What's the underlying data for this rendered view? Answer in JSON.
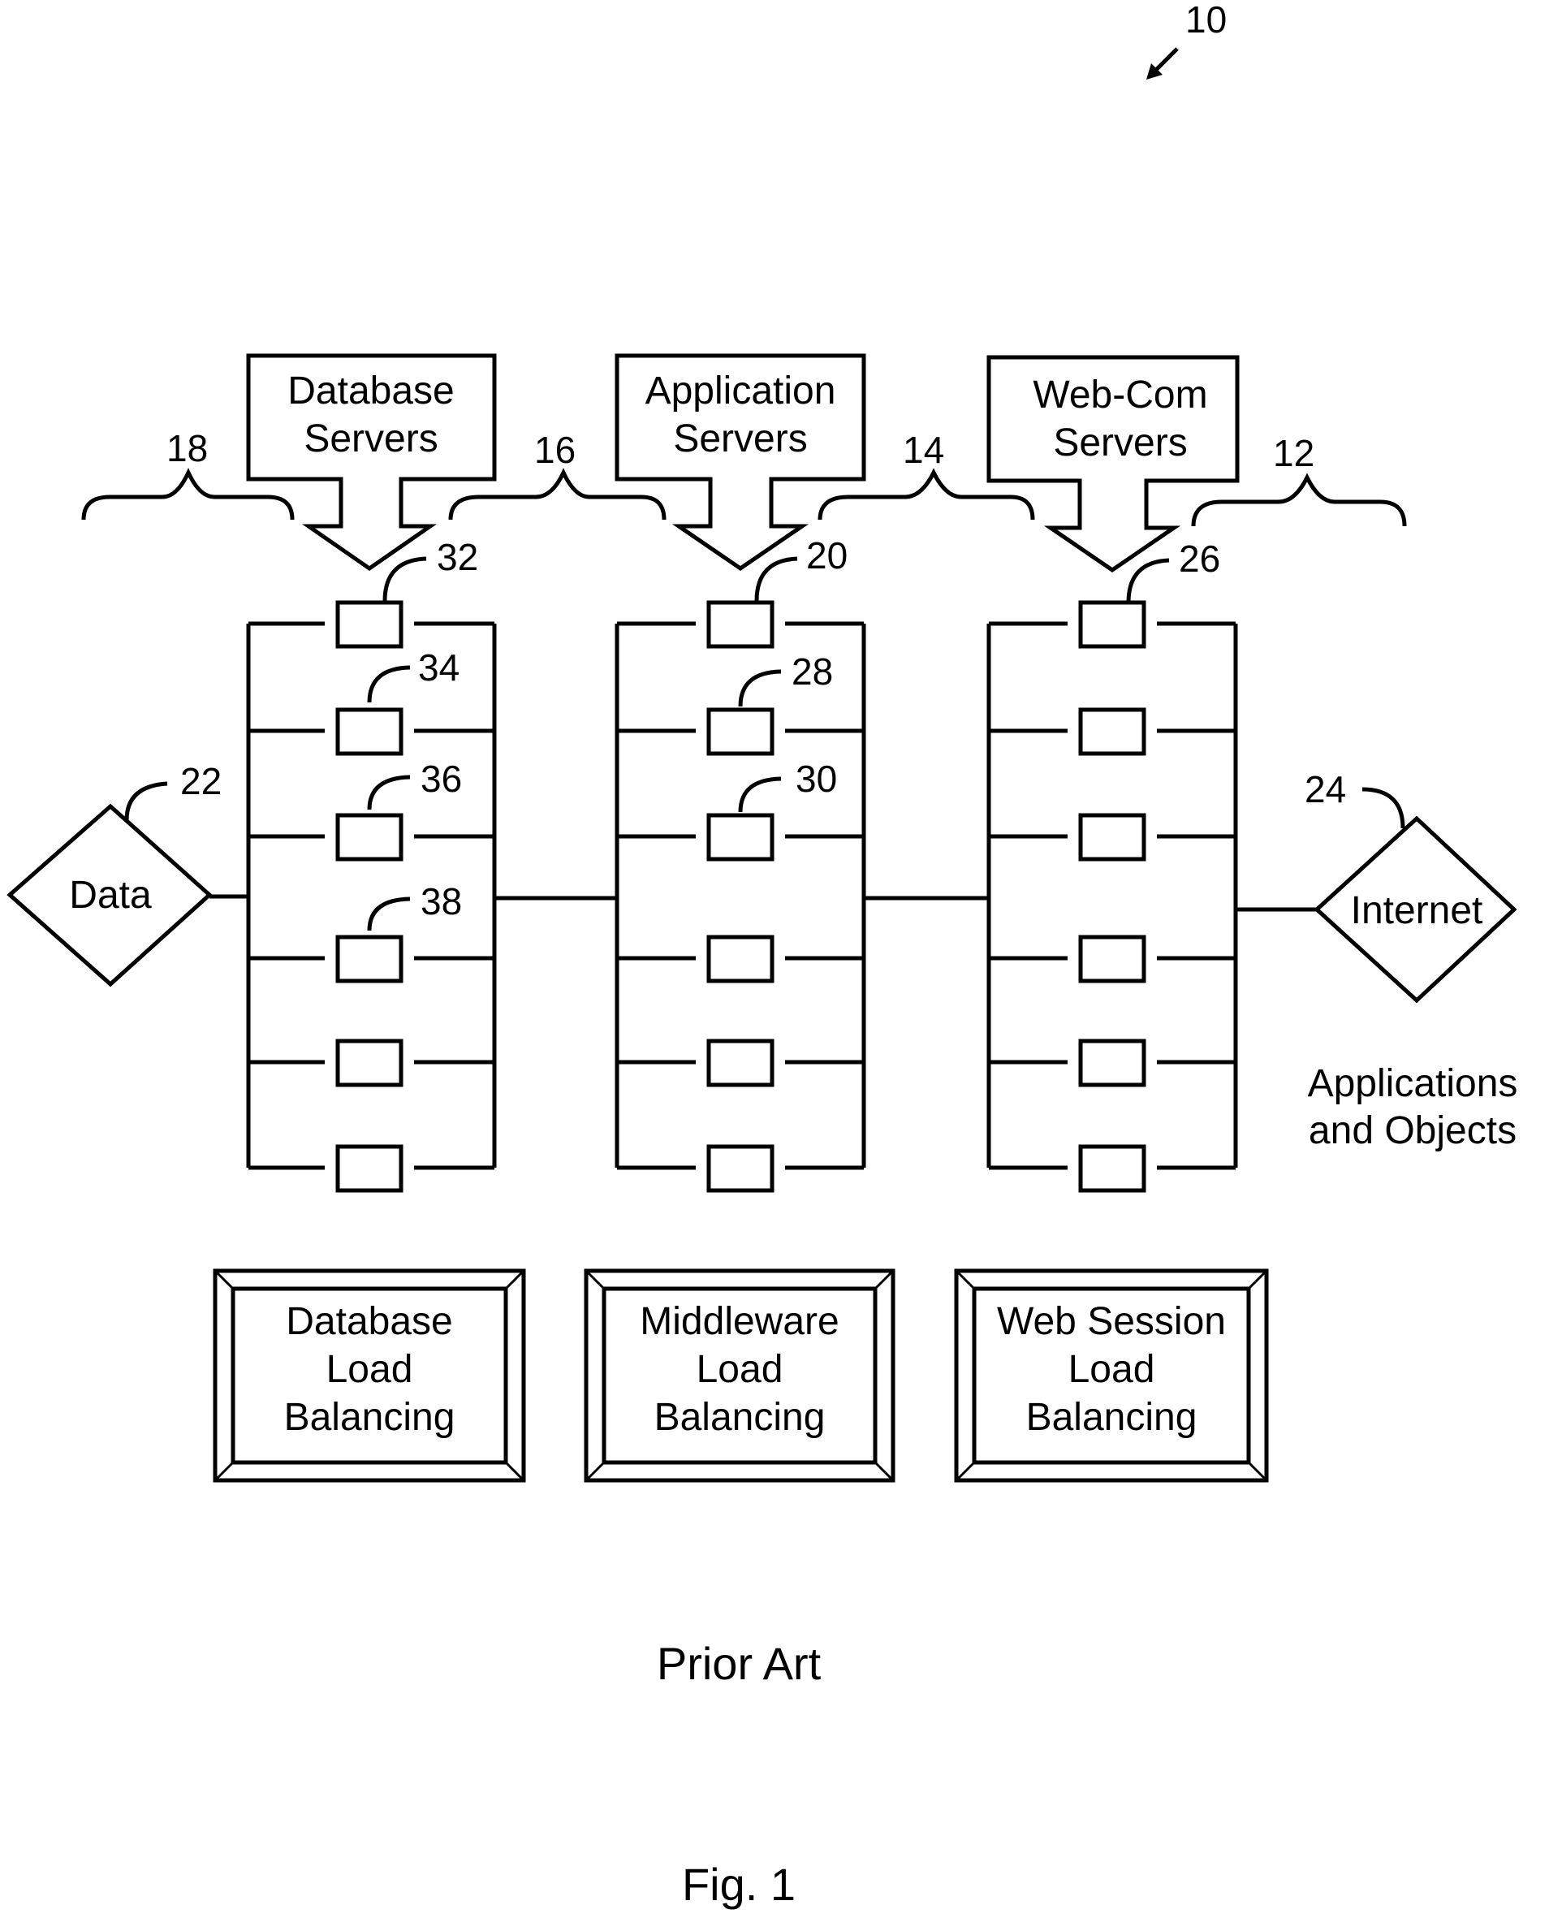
{
  "figure": {
    "ref_number": "10",
    "caption": "Prior Art",
    "fig_label": "Fig. 1"
  },
  "tiers": [
    {
      "id": "database",
      "ref": "18",
      "callout_line1": "Database",
      "callout_line2": "Servers",
      "callout_ref": "32",
      "server_refs": [
        "34",
        "36",
        "38"
      ],
      "balancer_line1": "Database",
      "balancer_line2": "Load",
      "balancer_line3": "Balancing"
    },
    {
      "id": "application",
      "ref": "16",
      "callout_line1": "Application",
      "callout_line2": "Servers",
      "callout_ref": "20",
      "server_refs": [
        "28",
        "30"
      ],
      "balancer_line1": "Middleware",
      "balancer_line2": "Load",
      "balancer_line3": "Balancing"
    },
    {
      "id": "webcom",
      "ref": "14",
      "callout_line1": "Web-Com",
      "callout_line2": "Servers",
      "callout_ref": "26",
      "server_refs": [],
      "balancer_line1": "Web Session",
      "balancer_line2": "Load",
      "balancer_line3": "Balancing"
    }
  ],
  "outer_ref": "12",
  "data_node": {
    "label": "Data",
    "ref": "22"
  },
  "internet_node": {
    "label": "Internet",
    "ref": "24"
  },
  "side_note": {
    "line1": "Applications",
    "line2": "and Objects"
  }
}
